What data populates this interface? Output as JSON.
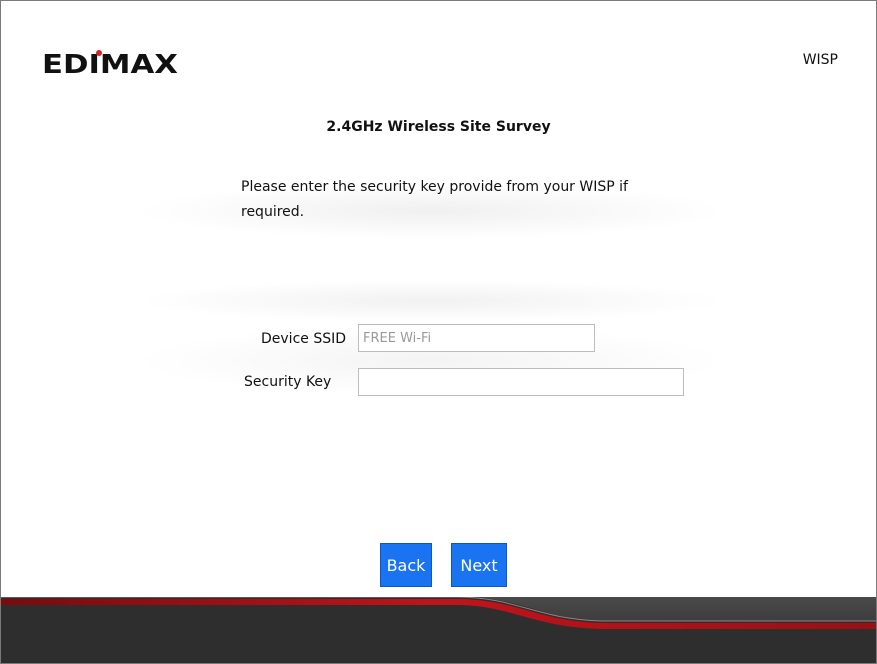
{
  "brand": {
    "logo_text": "EDIMAX"
  },
  "header": {
    "mode_label": "WISP"
  },
  "page": {
    "title": "2.4GHz Wireless Site Survey",
    "instruction": "Please enter the security key provide from your WISP if required."
  },
  "form": {
    "ssid_label": "Device SSID",
    "ssid_value": "FREE Wi-Fi",
    "key_label": "Security Key",
    "key_value": ""
  },
  "buttons": {
    "back": "Back",
    "next": "Next"
  },
  "colors": {
    "button_blue": "#1a73f0",
    "footer_dark": "#2e2e2e",
    "footer_red": "#c0141b",
    "logo_red": "#e02020"
  }
}
